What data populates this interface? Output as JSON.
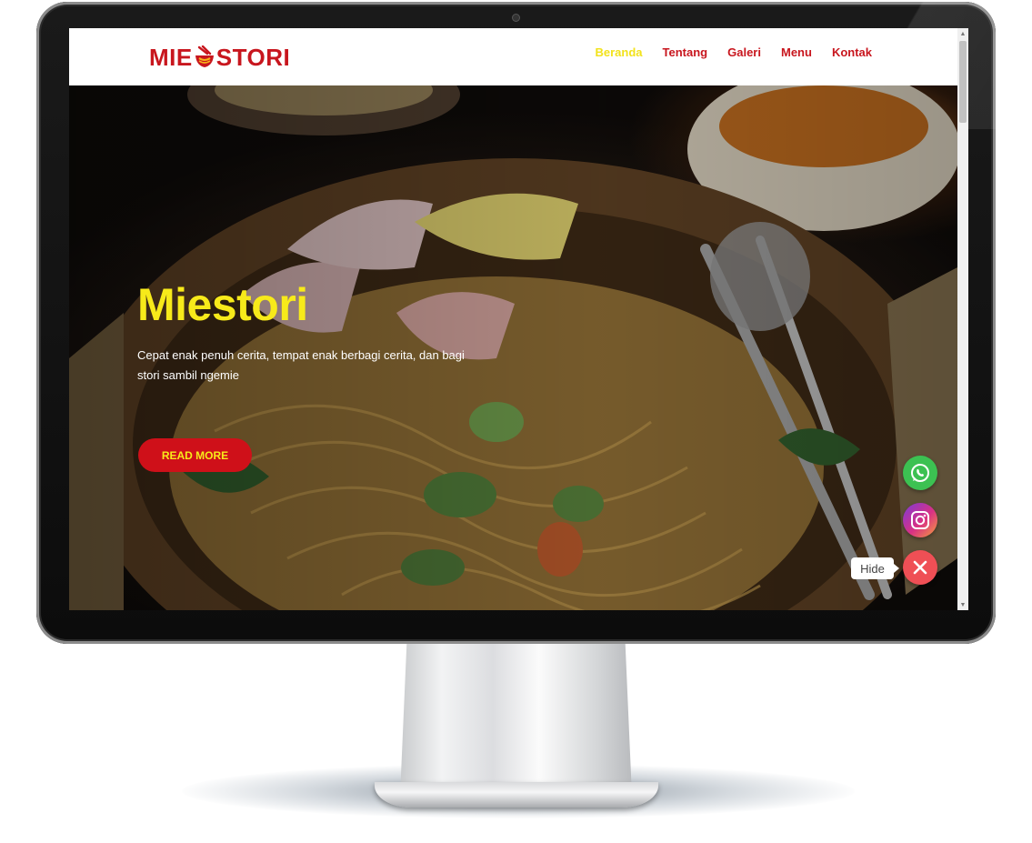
{
  "site": {
    "logo_text_left": "MIE",
    "logo_text_right": "STORI"
  },
  "nav": {
    "items": [
      {
        "label": "Beranda",
        "active": true
      },
      {
        "label": "Tentang",
        "active": false
      },
      {
        "label": "Galeri",
        "active": false
      },
      {
        "label": "Menu",
        "active": false
      },
      {
        "label": "Kontak",
        "active": false
      }
    ]
  },
  "hero": {
    "title": "Miestori",
    "description": "Cepat enak penuh cerita, tempat enak berbagi cerita, dan bagi stori sambil ngemie",
    "cta_label": "READ MORE"
  },
  "floating": {
    "whatsapp_icon": "whatsapp-icon",
    "instagram_icon": "instagram-icon",
    "close_icon": "close-icon",
    "hide_label": "Hide"
  },
  "colors": {
    "brand_red": "#c8161e",
    "brand_yellow": "#f7ea1a",
    "whatsapp_green": "#3cc152",
    "close_red": "#ef4f55"
  }
}
